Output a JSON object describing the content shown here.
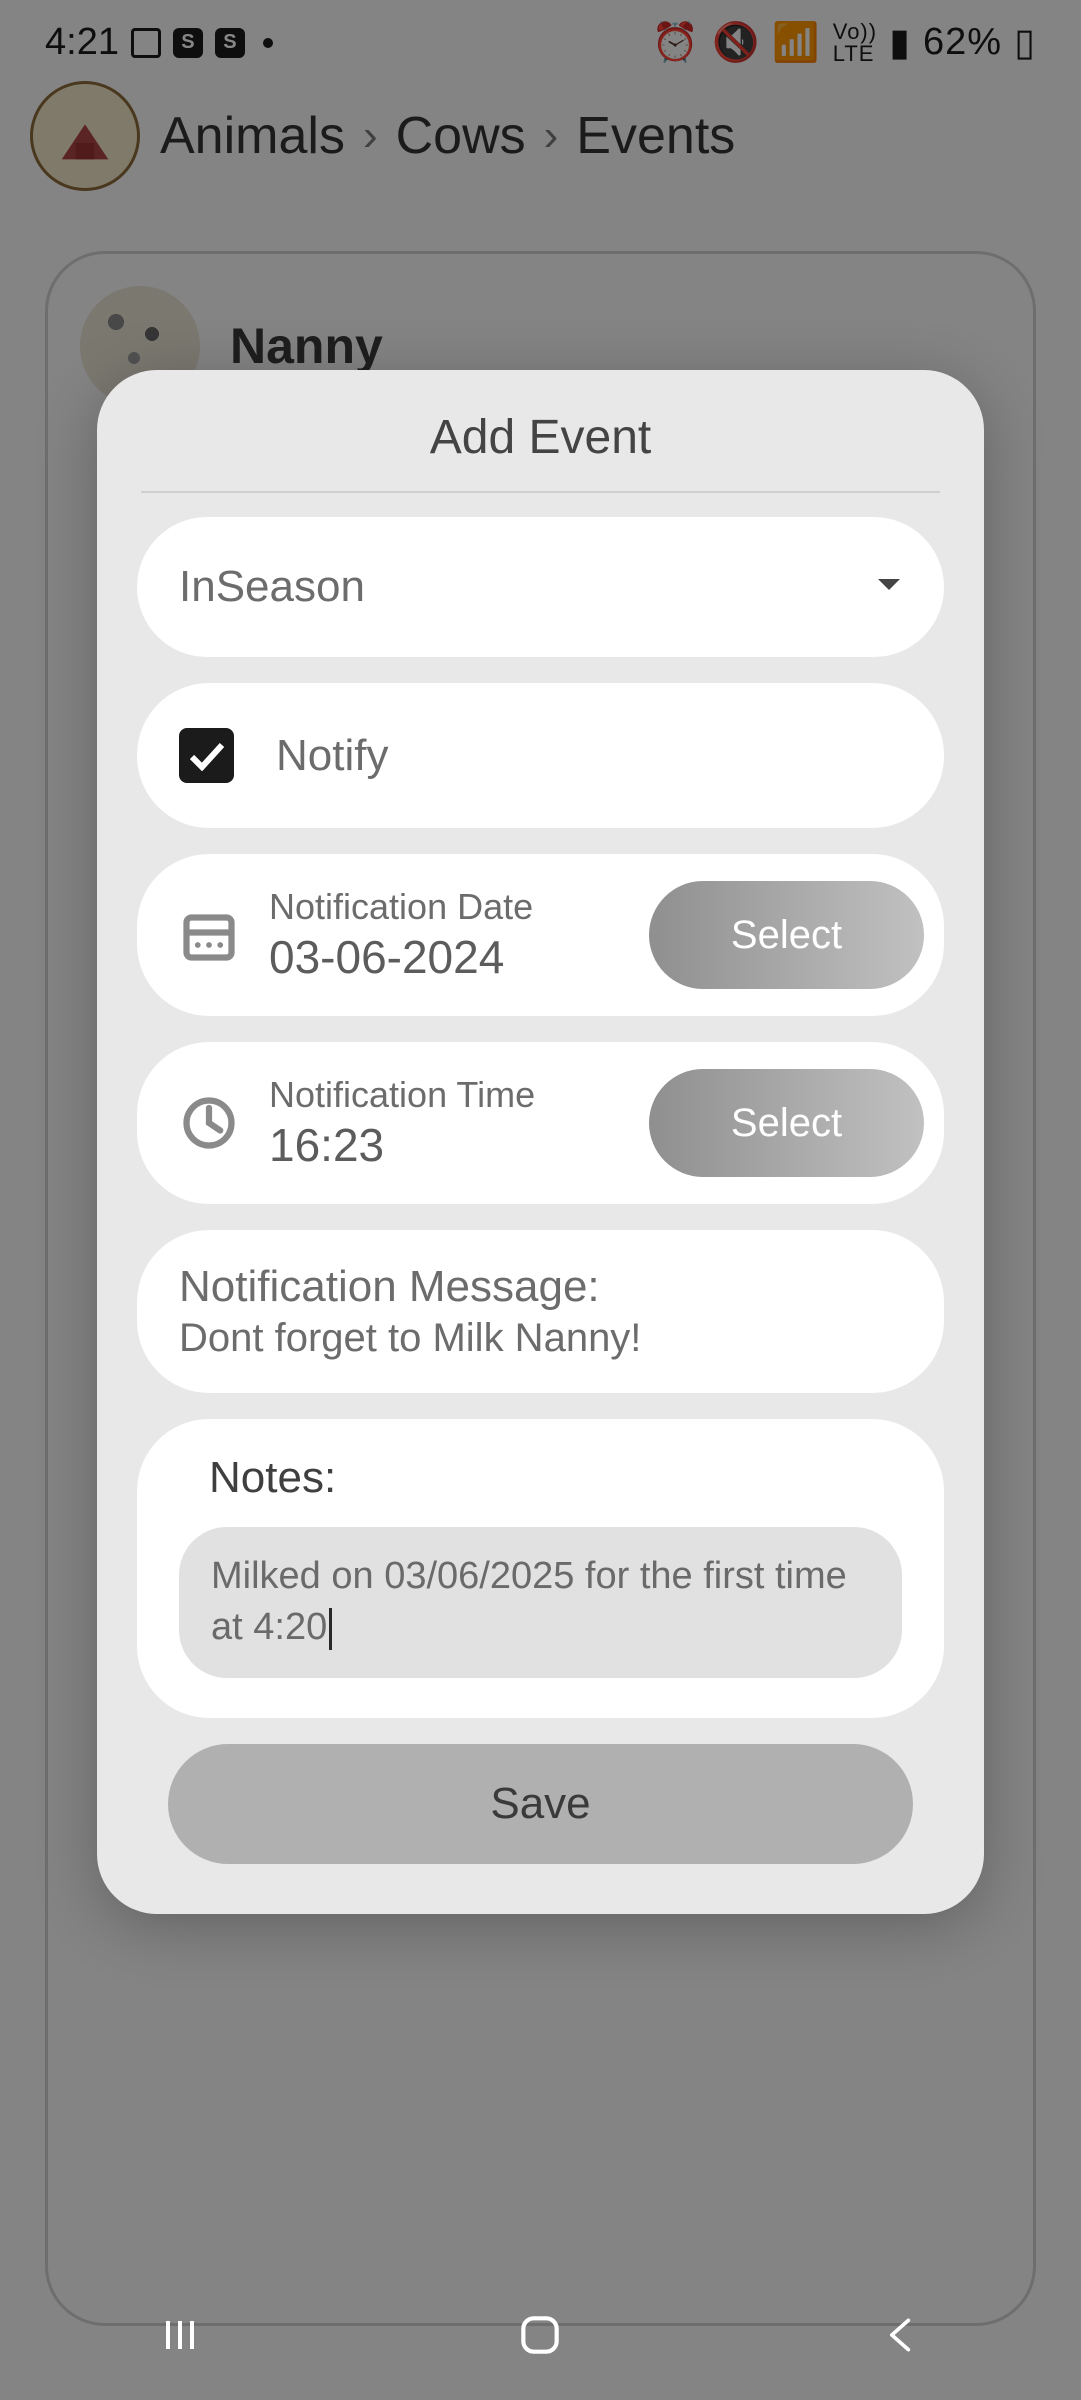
{
  "status": {
    "time": "4:21",
    "battery_text": "62%"
  },
  "breadcrumb": {
    "a": "Animals",
    "b": "Cows",
    "c": "Events"
  },
  "card": {
    "name": "Nanny"
  },
  "modal": {
    "title": "Add Event",
    "event_type": "InSeason",
    "notify_label": "Notify",
    "date_label": "Notification Date",
    "date_value": "03-06-2024",
    "time_label": "Notification Time",
    "time_value": "16:23",
    "select_label": "Select",
    "message_label": "Notification Message:",
    "message_value": "Dont forget to Milk Nanny!",
    "notes_label": "Notes:",
    "notes_value": "Milked on 03/06/2025 for the first time at 4:20",
    "save_label": "Save"
  }
}
